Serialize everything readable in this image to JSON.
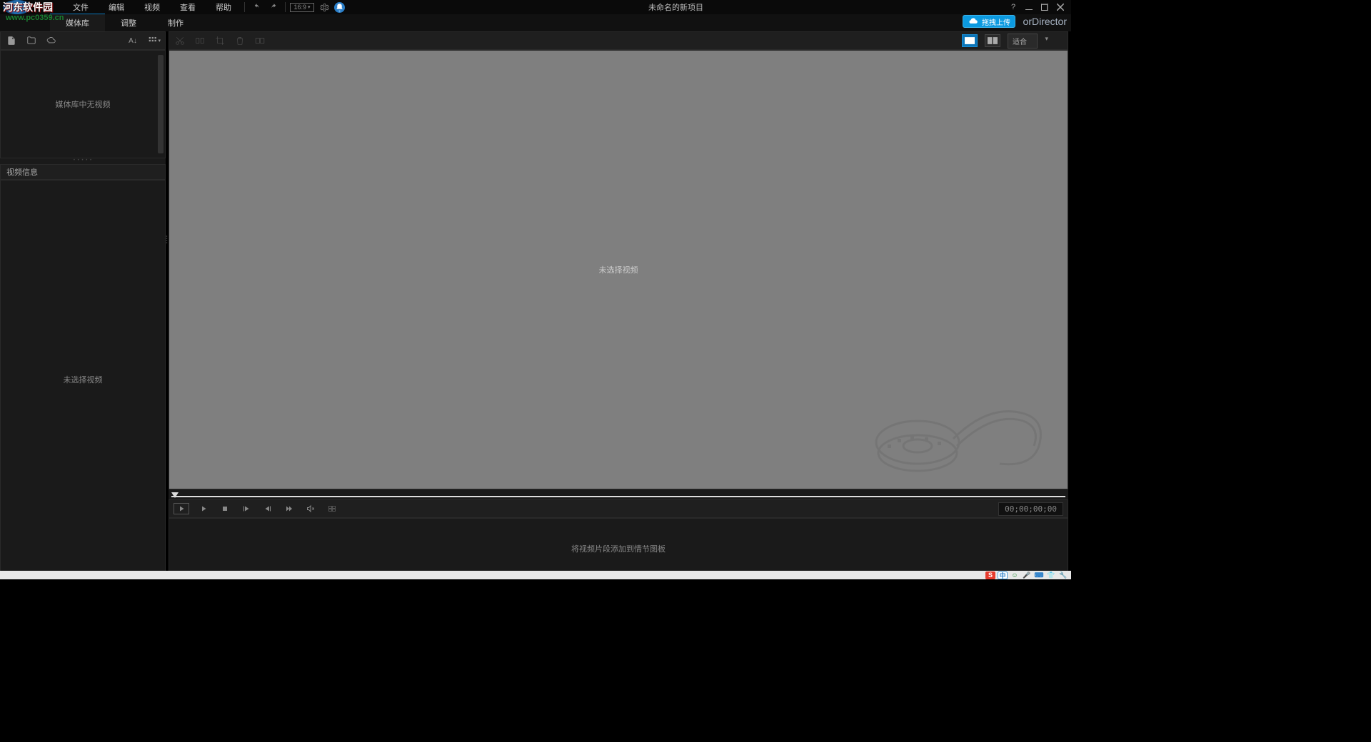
{
  "watermark": {
    "text": "河东软件园",
    "url": "www.pc0359.cn"
  },
  "menu": {
    "file": "文件",
    "edit": "编辑",
    "video": "视频",
    "view": "查看",
    "help": "帮助"
  },
  "title": "未命名的新项目",
  "brand_suffix": "orDirector",
  "upload_badge": "拖拽上传",
  "tabs": {
    "library": "媒体库",
    "adjust": "调整",
    "produce": "制作"
  },
  "left": {
    "sort_label": "A↓",
    "media_empty": "媒体库中无视频",
    "info_header": "视频信息",
    "info_empty": "未选择视频"
  },
  "main": {
    "preview_empty": "未选择视频",
    "fit_label": "适合",
    "timecode": "00;00;00;00",
    "storyboard_hint": "将视频片段添加到情节图板"
  },
  "icons": {
    "undo": "undo",
    "redo": "redo",
    "aspect": "16:9",
    "settings": "gear",
    "notify": "bell"
  }
}
